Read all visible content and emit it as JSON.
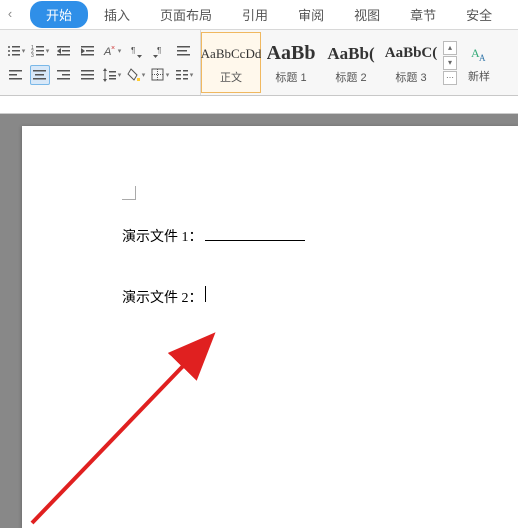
{
  "tabs": {
    "edge_left": "‹",
    "active": "开始",
    "items": [
      "插入",
      "页面布局",
      "引用",
      "审阅",
      "视图",
      "章节",
      "安全"
    ]
  },
  "ribbon": {
    "para_icons": {
      "r1": [
        "list-bullet",
        "list-number",
        "indent-dec",
        "indent-inc",
        "formatting",
        "ltr",
        "rtl",
        "pilcrow"
      ],
      "r2": [
        "align-left",
        "align-center",
        "align-right",
        "align-justify",
        "line-spacing",
        "shading",
        "borders",
        "tabs-icon"
      ]
    },
    "styles": [
      {
        "preview": "AaBbCcDd",
        "label": "正文",
        "size": "13px",
        "weight": "400",
        "sel": true
      },
      {
        "preview": "AaBb",
        "label": "标题 1",
        "size": "20px",
        "weight": "700",
        "sel": false
      },
      {
        "preview": "AaBb(",
        "label": "标题 2",
        "size": "17px",
        "weight": "700",
        "sel": false
      },
      {
        "preview": "AaBbC(",
        "label": "标题 3",
        "size": "15px",
        "weight": "700",
        "sel": false
      }
    ],
    "style_nav": {
      "up": "▴",
      "down": "▾",
      "more": "⋯"
    },
    "new_style_label": "新样"
  },
  "document": {
    "line1_label": "演示文件 1：",
    "line2_label": "演示文件 2："
  }
}
